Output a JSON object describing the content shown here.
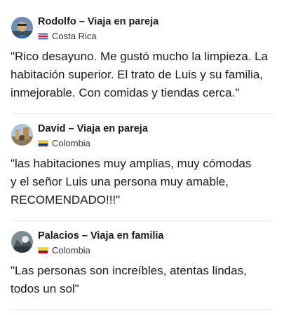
{
  "reviews": [
    {
      "reviewer": "Rodolfo – Viaja en pareja",
      "country": "Costa Rica",
      "text": "\"Rico desayuno. Me gustó mucho la limpieza. La\nhabitación superior. El trato de Luis y su familia,\ninmejorable. Con comidas y tiendas cerca.\""
    },
    {
      "reviewer": "David – Viaja en pareja",
      "country": "Colombia",
      "text": "\"las habitaciones muy amplias, muy cómodas\ny el señor Luis una persona muy amable,\nRECOMENDADO!!!\""
    },
    {
      "reviewer": "Palacios – Viaja en familia",
      "country": "Colombia",
      "text": "\"Las personas son increíbles, atentas lindas,\ntodos un sol\""
    }
  ],
  "colors": {
    "text": "#1a1a1a",
    "divider": "#e6e6e6",
    "flag_costa_rica": [
      "#002b7f",
      "#ffffff",
      "#ce1126"
    ],
    "flag_colombia": [
      "#fcd116",
      "#003893",
      "#ce1126"
    ]
  }
}
